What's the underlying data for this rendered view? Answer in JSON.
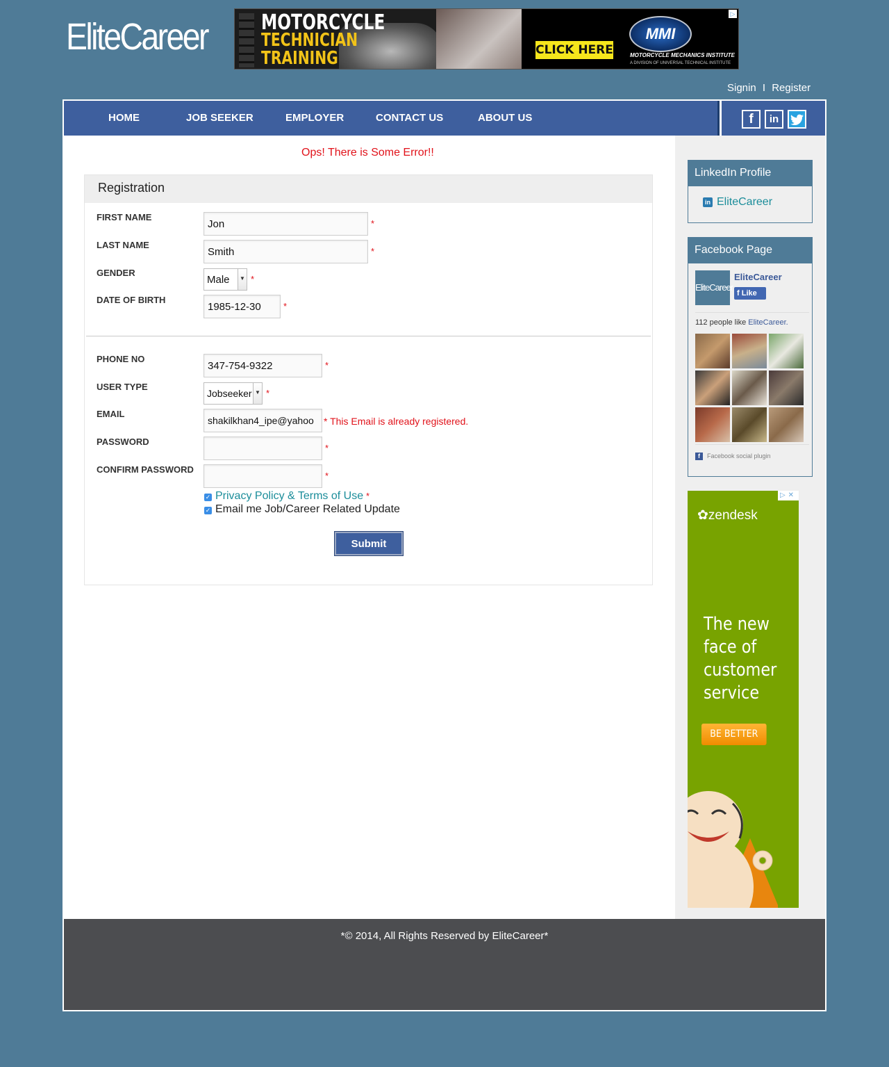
{
  "header": {
    "logo": "EliteCareer",
    "ad": {
      "line1": "MOTORCYCLE",
      "line2": "TECHNICIAN",
      "line3": "TRAINING",
      "cta": "CLICK HERE",
      "brand": "MMI",
      "brand_sub": "MOTORCYCLE MECHANICS INSTITUTE",
      "brand_sub2": "A DIVISION OF UNIVERSAL TECHNICAL INSTITUTE"
    },
    "signin": "Signin",
    "separator": "I",
    "register": "Register"
  },
  "nav": {
    "items": [
      "HOME",
      "JOB SEEKER",
      "EMPLOYER",
      "CONTACT US",
      "ABOUT US"
    ],
    "social": [
      "facebook-icon",
      "linkedin-icon",
      "twitter-icon"
    ]
  },
  "main": {
    "error_banner": "Ops! There is Some Error!!",
    "panel_title": "Registration",
    "fields": {
      "first_name": {
        "label": "FIRST NAME",
        "value": "Jon"
      },
      "last_name": {
        "label": "LAST NAME",
        "value": "Smith"
      },
      "gender": {
        "label": "GENDER",
        "value": "Male"
      },
      "dob": {
        "label": "DATE OF BIRTH",
        "value": "1985-12-30"
      },
      "phone": {
        "label": "PHONE NO",
        "value": "347-754-9322"
      },
      "user_type": {
        "label": "USER TYPE",
        "value": "Jobseeker"
      },
      "email": {
        "label": "EMAIL",
        "value": "shakilkhan4_ipe@yahoo",
        "error": "* This Email is already registered."
      },
      "password": {
        "label": "PASSWORD",
        "value": ""
      },
      "confirm_password": {
        "label": "CONFIRM PASSWORD",
        "value": ""
      }
    },
    "required_mark": "*",
    "checkbox_privacy": "Privacy Policy & Terms of Use",
    "checkbox_updates": "Email me Job/Career Related Update",
    "submit": "Submit"
  },
  "sidebar": {
    "linkedin": {
      "title": "LinkedIn Profile",
      "link": "EliteCareer"
    },
    "facebook": {
      "title": "Facebook Page",
      "logo": "EliteCareer",
      "page_name": "EliteCareer",
      "like": "Like",
      "count_text": "112 people like",
      "count_link": "EliteCareer.",
      "plugin": "Facebook social plugin"
    },
    "ad": {
      "logo": "zendesk",
      "text": "The new face of customer service",
      "button": "BE BETTER"
    }
  },
  "footer": {
    "text": "*© 2014, All Rights Reserved by EliteCareer*"
  },
  "colors": {
    "background": "#4f7b97",
    "nav": "#3e5f9e",
    "error": "#e1121a",
    "link": "#1b8d9a",
    "footer": "#4c4d50",
    "zendesk_green": "#78a300"
  }
}
